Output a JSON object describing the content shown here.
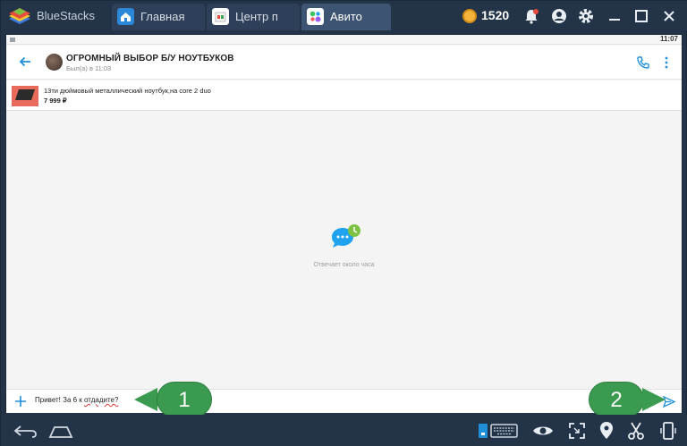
{
  "titlebar": {
    "app_name": "BlueStacks",
    "coins": "1520",
    "tabs": [
      {
        "label": "Главная",
        "icon": "home-icon"
      },
      {
        "label": "Центр п",
        "icon": "app-center-icon"
      },
      {
        "label": "Авито",
        "icon": "avito-icon"
      }
    ],
    "icons": [
      "bell-icon",
      "account-icon",
      "settings-gear-icon",
      "minimize-icon",
      "maximize-icon",
      "close-icon"
    ]
  },
  "android": {
    "status_time": "11:07",
    "chat": {
      "title": "ОГРОМНЫЙ ВЫБОР Б/У НОУТБУКОВ",
      "subtitle": "Был(а) в 11:03"
    },
    "product": {
      "title": "13ти дюймовый металлический ноутбук,на core 2 duo",
      "price": "7 999 ₽"
    },
    "empty_state": {
      "text": "Отвечает около часа",
      "icon": "chat-bubble-clock-icon"
    },
    "input": {
      "text_before": "Привет! За 6 к ",
      "text_error": "отдадите?",
      "icons": [
        "add-icon",
        "send-icon"
      ]
    }
  },
  "callouts": [
    {
      "label": "1"
    },
    {
      "label": "2"
    }
  ],
  "bottombar": {
    "icons": [
      "back-icon",
      "home-outline-icon",
      "keyboard-icon",
      "eye-icon",
      "fullscreen-icon",
      "location-icon",
      "scissors-icon",
      "rotate-device-icon"
    ]
  },
  "colors": {
    "chrome": "#233449",
    "accent_blue": "#1f8fdc",
    "callout_green": "#3a9a4f",
    "empty_icon_blue": "#1fa2f0",
    "empty_icon_green": "#7dc242"
  }
}
